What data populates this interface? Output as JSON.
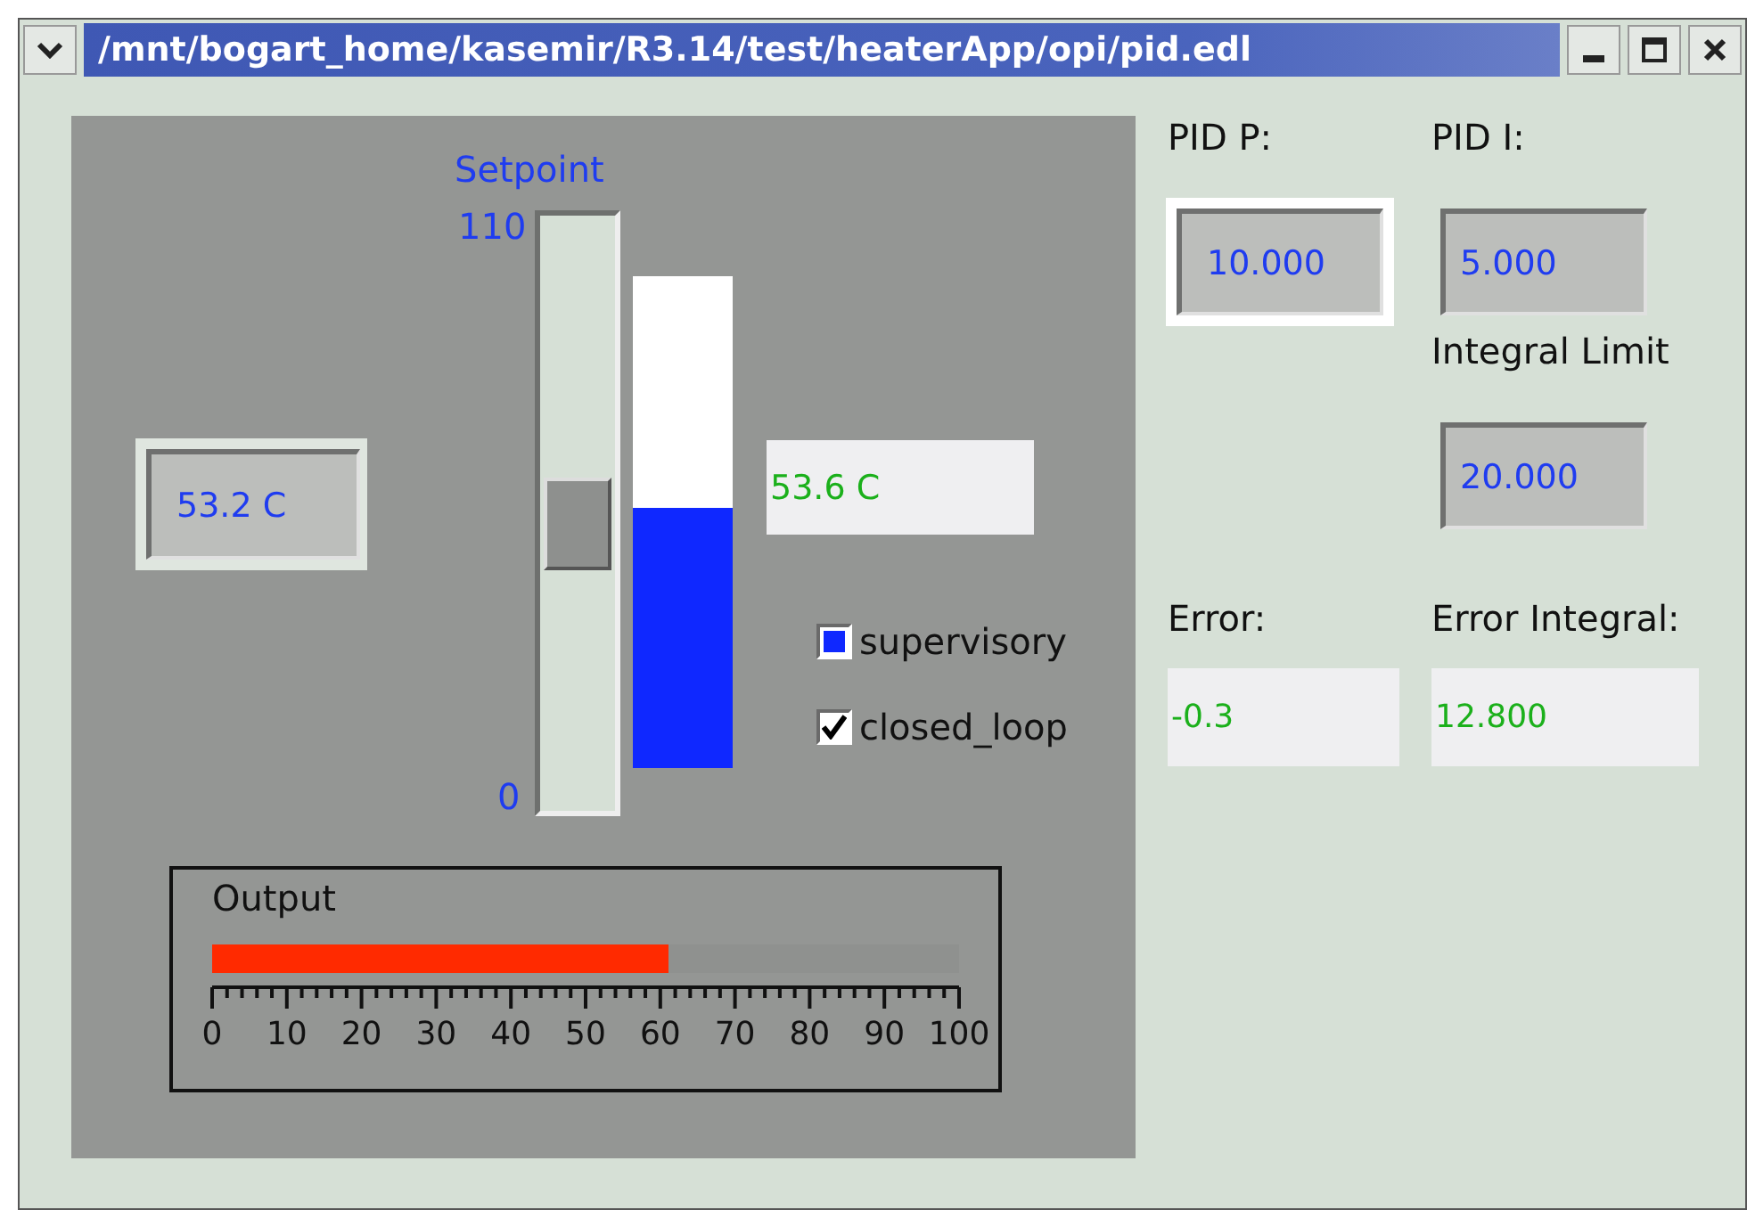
{
  "window": {
    "title": "/mnt/bogart_home/kasemir/R3.14/test/heaterApp/opi/pid.edl"
  },
  "setpoint": {
    "label": "Setpoint",
    "max": "110",
    "min": "0",
    "level": 0.48
  },
  "temperature_input": {
    "value": "53.2 C"
  },
  "temperature_bar": {
    "level": 0.53
  },
  "temperature_reading": {
    "value": "53.6 C"
  },
  "checkboxes": [
    {
      "label": "supervisory",
      "checked": false
    },
    {
      "label": "closed_loop",
      "checked": true
    }
  ],
  "output": {
    "label": "Output",
    "level": 0.61,
    "scale": [
      "0",
      "10",
      "20",
      "30",
      "40",
      "50",
      "60",
      "70",
      "80",
      "90",
      "100"
    ]
  },
  "pid_p": {
    "label": "PID P:",
    "value": "10.000",
    "focused": true
  },
  "pid_i": {
    "label": "PID I:",
    "value": "5.000",
    "focused": false
  },
  "integral_limit": {
    "label": "Integral Limit",
    "value": "20.000",
    "focused": false
  },
  "error": {
    "label": "Error:",
    "value": "-0.3"
  },
  "error_integral": {
    "label": "Error Integral:",
    "value": "12.800"
  }
}
